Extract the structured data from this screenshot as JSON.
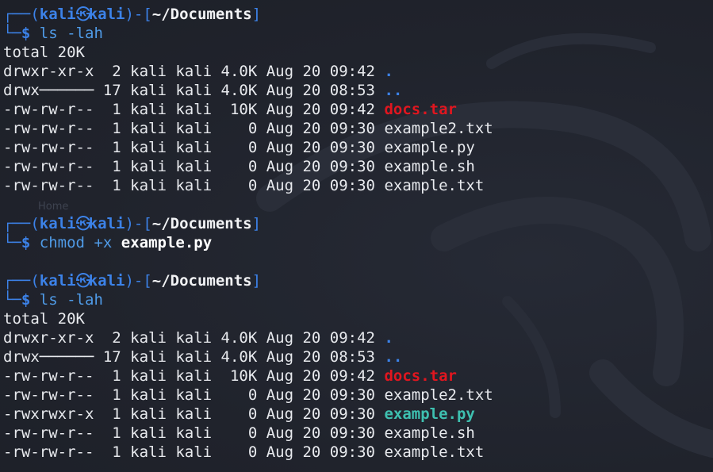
{
  "theme": {
    "background": "#20232c",
    "prompt_color": "#3c82e8",
    "directory_color": "#3c82e8",
    "archive_color": "#e0161f",
    "executable_color": "#3ec0b0",
    "text_color": "#e8eaee"
  },
  "prompt": {
    "user": "kali",
    "host": "kali",
    "cwd": "~/Documents",
    "symbol": "$",
    "at_icon": "kali-skull-icon"
  },
  "background_text": "Home",
  "commands": [
    {
      "cmd": "ls",
      "args": " -lah",
      "output": {
        "total": "total 20K",
        "rows": [
          {
            "meta": "drwxr-xr-x  2 kali kali 4.0K Aug 20 09:42 ",
            "name": ".",
            "kind": "dir"
          },
          {
            "meta": "drwx────── 17 kali kali 4.0K Aug 20 08:53 ",
            "name": "..",
            "kind": "dir"
          },
          {
            "meta": "-rw-rw-r--  1 kali kali  10K Aug 20 09:42 ",
            "name": "docs.tar",
            "kind": "archive"
          },
          {
            "meta": "-rw-rw-r--  1 kali kali    0 Aug 20 09:30 ",
            "name": "example2.txt",
            "kind": "file"
          },
          {
            "meta": "-rw-rw-r--  1 kali kali    0 Aug 20 09:30 ",
            "name": "example.py",
            "kind": "file"
          },
          {
            "meta": "-rw-rw-r--  1 kali kali    0 Aug 20 09:30 ",
            "name": "example.sh",
            "kind": "file"
          },
          {
            "meta": "-rw-rw-r--  1 kali kali    0 Aug 20 09:30 ",
            "name": "example.txt",
            "kind": "file"
          }
        ]
      }
    },
    {
      "cmd": "chmod",
      "args": " +x ",
      "target": "example.py",
      "output": null
    },
    {
      "cmd": "ls",
      "args": " -lah",
      "output": {
        "total": "total 20K",
        "rows": [
          {
            "meta": "drwxr-xr-x  2 kali kali 4.0K Aug 20 09:42 ",
            "name": ".",
            "kind": "dir"
          },
          {
            "meta": "drwx────── 17 kali kali 4.0K Aug 20 08:53 ",
            "name": "..",
            "kind": "dir"
          },
          {
            "meta": "-rw-rw-r--  1 kali kali  10K Aug 20 09:42 ",
            "name": "docs.tar",
            "kind": "archive"
          },
          {
            "meta": "-rw-rw-r--  1 kali kali    0 Aug 20 09:30 ",
            "name": "example2.txt",
            "kind": "file"
          },
          {
            "meta": "-rwxrwxr-x  1 kali kali    0 Aug 20 09:30 ",
            "name": "example.py",
            "kind": "exec"
          },
          {
            "meta": "-rw-rw-r--  1 kali kali    0 Aug 20 09:30 ",
            "name": "example.sh",
            "kind": "file"
          },
          {
            "meta": "-rw-rw-r--  1 kali kali    0 Aug 20 09:30 ",
            "name": "example.txt",
            "kind": "file"
          }
        ]
      }
    }
  ]
}
